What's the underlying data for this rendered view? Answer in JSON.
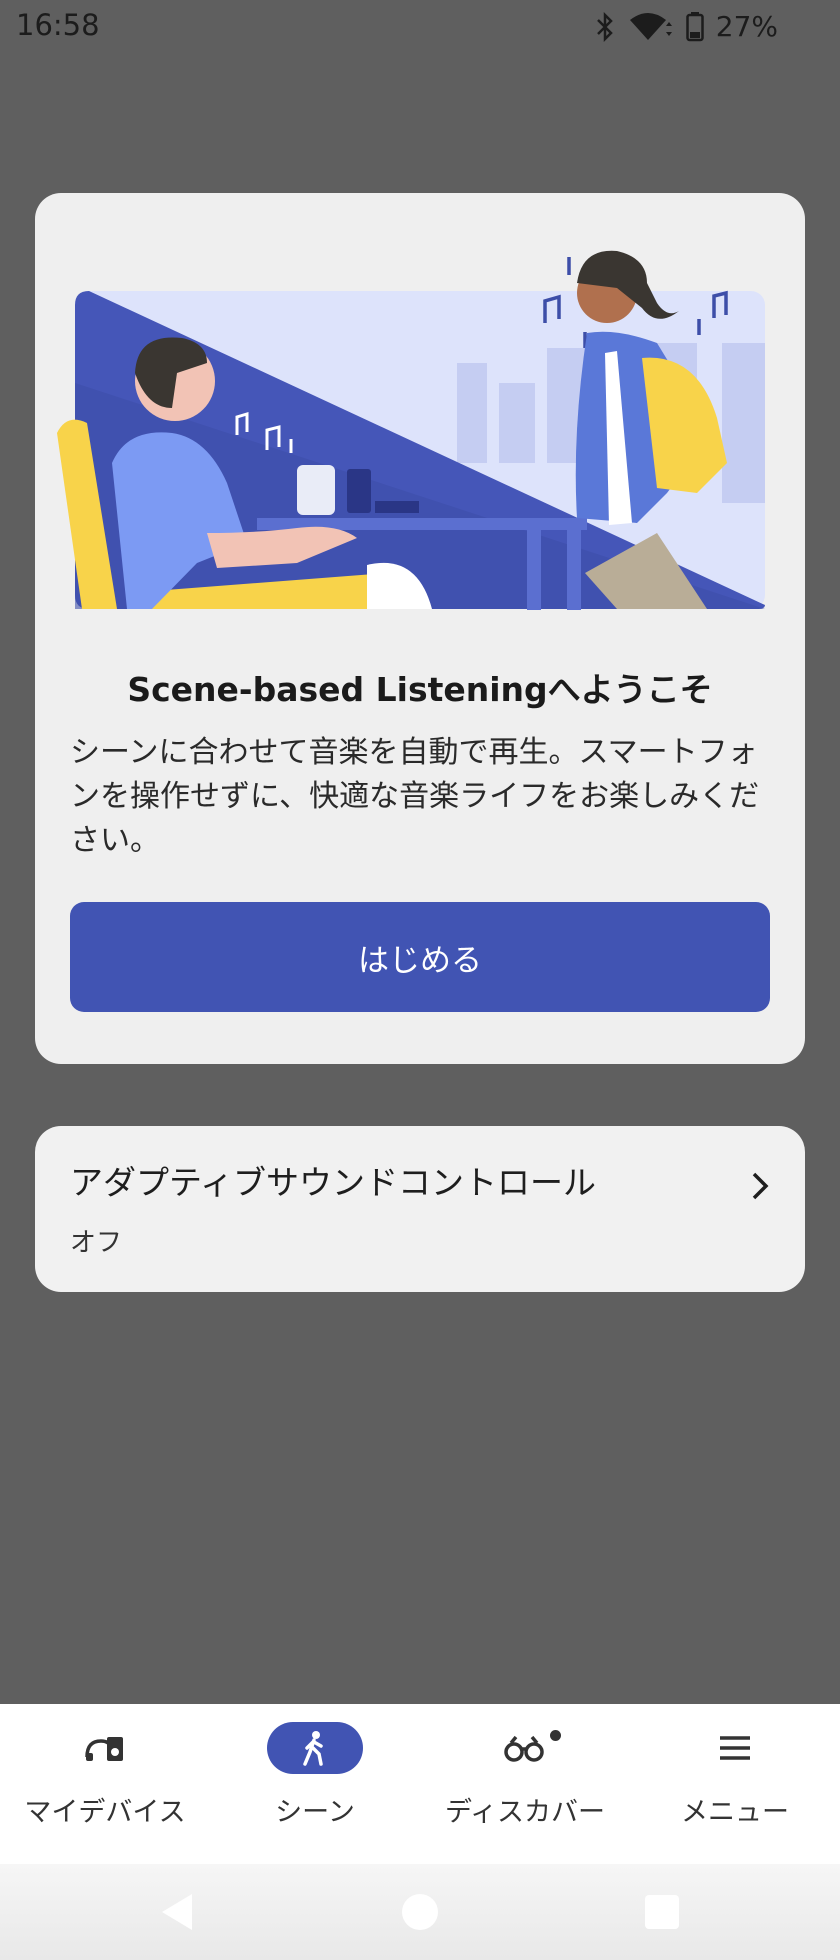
{
  "status_bar": {
    "time": "16:58",
    "battery": "27%",
    "icons": [
      "bluetooth-icon",
      "wifi-icon",
      "battery-icon"
    ]
  },
  "welcome_card": {
    "illustration": "scene-illustration",
    "title": "Scene-based Listeningへようこそ",
    "description": "シーンに合わせて音楽を自動で再生。スマートフォンを操作せずに、快適な音楽ライフをお楽しみください。",
    "start_button": "はじめる"
  },
  "adaptive_sound_control": {
    "title": "アダプティブサウンドコントロール",
    "status": "オフ"
  },
  "bottom_nav": {
    "items": [
      {
        "label": "マイデバイス",
        "icon": "device-icon",
        "active": false
      },
      {
        "label": "シーン",
        "icon": "walking-icon",
        "active": true
      },
      {
        "label": "ディスカバー",
        "icon": "binoculars-icon",
        "active": false
      },
      {
        "label": "メニュー",
        "icon": "menu-icon",
        "active": false
      }
    ]
  },
  "colors": {
    "accent": "#4154b3",
    "scrim": "#5f5f5f",
    "card": "#efefef",
    "illustration_yellow": "#f8d34a"
  }
}
